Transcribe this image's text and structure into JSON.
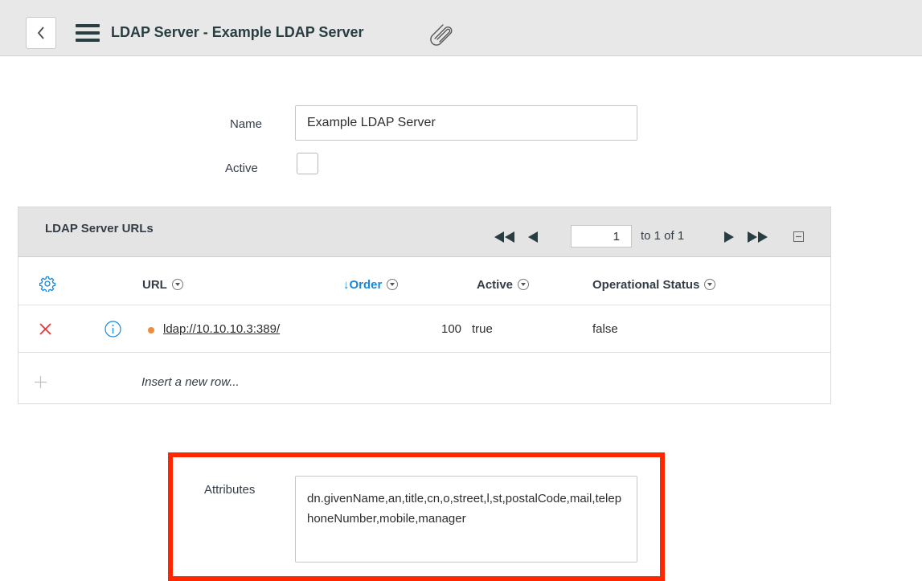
{
  "header": {
    "title": "LDAP Server - Example LDAP Server",
    "back_icon": "chevron-left-icon",
    "menu_icon": "hamburger-menu-icon",
    "attachment_icon": "paperclip-icon"
  },
  "form": {
    "name_label": "Name",
    "name_value": "Example LDAP Server",
    "active_label": "Active",
    "active_checked": false,
    "attributes_label": "Attributes",
    "attributes_value": "dn.givenName,an,title,cn,o,street,l,st,postalCode,mail,telephoneNumber,mobile,manager"
  },
  "related_list": {
    "title": "LDAP Server URLs",
    "pager": {
      "page": "1",
      "range_text": "to 1 of 1"
    },
    "columns": [
      {
        "label": "URL"
      },
      {
        "label": "Order",
        "sorted": "descending"
      },
      {
        "label": "Active"
      },
      {
        "label": "Operational Status"
      }
    ],
    "rows": [
      {
        "url": "ldap://10.10.10.3:389/",
        "order": "100",
        "active": "true",
        "operational_status": "false"
      }
    ],
    "insert_row_text": "Insert a new row..."
  },
  "colors": {
    "accent": "#1a87d9",
    "delete": "#e03b3b",
    "status_dot": "#f28a3c",
    "highlight": "#ff2600"
  }
}
